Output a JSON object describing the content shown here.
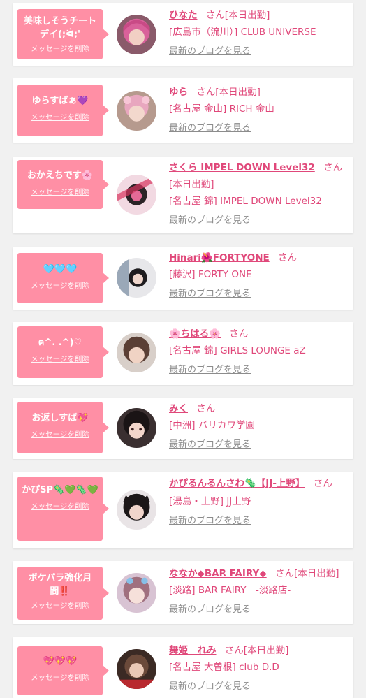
{
  "colors": {
    "accent": "#e0487a",
    "bubble": "#ff8fa5",
    "background": "#f1f1f1",
    "link_gray": "#8c8c8c"
  },
  "cards": [
    {
      "message": "美味しそうチートデイ(;ᐛ;'",
      "delete_label": "メッセージを削除",
      "name": "ひなた",
      "honorific": "さん",
      "status": "[本日出勤]",
      "shop": "[広島市（流川）] CLUB UNIVERSE",
      "blog_label": "最新のブログを見る"
    },
    {
      "message": "ゆらすばぁ💜",
      "delete_label": "メッセージを削除",
      "name": "ゆら",
      "honorific": "さん",
      "status": "[本日出勤]",
      "shop": "[名古屋 金山] RICH 金山",
      "blog_label": "最新のブログを見る"
    },
    {
      "message": "おかえちです🌸",
      "delete_label": "メッセージを削除",
      "name": "さくら IMPEL DOWN Level32",
      "honorific": "さん",
      "status": "[本日出勤]",
      "shop": "[名古屋 錦] IMPEL DOWN Level32",
      "blog_label": "最新のブログを見る"
    },
    {
      "message": "🩵🩵🩵",
      "delete_label": "メッセージを削除",
      "name": "Hinari🌺FORTYONE",
      "honorific": "さん",
      "status": "",
      "shop": "[藤沢] FORTY ONE",
      "blog_label": "最新のブログを見る"
    },
    {
      "message": "ฅ^. .^)♡",
      "delete_label": "メッセージを削除",
      "name": "🌸ちはる🌸",
      "honorific": "さん",
      "status": "",
      "shop": "[名古屋 錦] GIRLS LOUNGE aZ",
      "blog_label": "最新のブログを見る"
    },
    {
      "message": "お返しすば💖",
      "delete_label": "メッセージを削除",
      "name": "みく",
      "honorific": "さん",
      "status": "",
      "shop": "[中洲] バリカワ学園",
      "blog_label": "最新のブログを見る"
    },
    {
      "message": "かぴSP🦠💚🦠💚",
      "delete_label": "メッセージを削除",
      "name": "かぴるんるんさわ🦠【JJ-上野】",
      "honorific": "さん",
      "status": "",
      "shop": "[湯島・上野] JJ上野",
      "blog_label": "最新のブログを見る"
    },
    {
      "message": "ボケパラ強化月間‼️",
      "delete_label": "メッセージを削除",
      "name": "ななか◆BAR FAIRY◆",
      "honorific": "さん",
      "status": "[本日出勤]",
      "shop": "[淡路] BAR FAIRY　-淡路店-",
      "blog_label": "最新のブログを見る"
    },
    {
      "message": "💖💖💖",
      "delete_label": "メッセージを削除",
      "name": "舞姫　れみ",
      "honorific": "さん",
      "status": "[本日出勤]",
      "shop": "[名古屋 大曽根] club D.D",
      "blog_label": "最新のブログを見る"
    }
  ]
}
